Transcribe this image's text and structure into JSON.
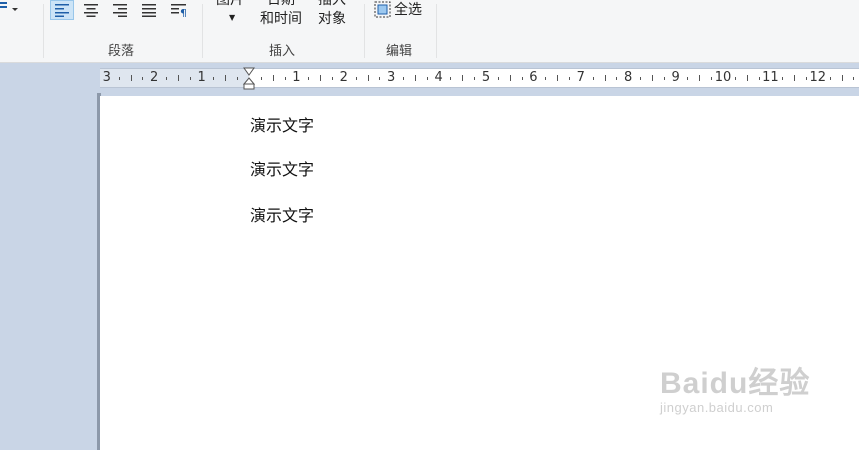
{
  "ribbon": {
    "groups": [
      {
        "label": "段落"
      },
      {
        "label": "插入"
      },
      {
        "label": "编辑"
      }
    ],
    "insert": {
      "picture_top": "图片",
      "datetime_top": "日期",
      "datetime_bottom": "和时间",
      "object_top": "插入",
      "object_bottom": "对象"
    },
    "edit": {
      "select_all": "全选"
    }
  },
  "ruler": {
    "numbers": [
      "3",
      "2",
      "1",
      "1",
      "2",
      "3",
      "4",
      "5",
      "6",
      "7",
      "8",
      "9",
      "10",
      "11",
      "12"
    ]
  },
  "document": {
    "lines": [
      "演示文字",
      "演示文字",
      "演示文字"
    ]
  },
  "watermark": {
    "main": "Baidu经验",
    "sub": "jingyan.baidu.com"
  }
}
